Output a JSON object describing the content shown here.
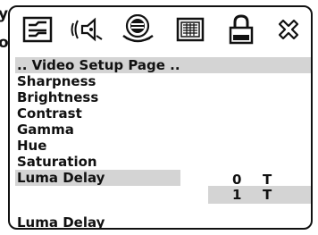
{
  "edge_labels": [
    "y",
    "o"
  ],
  "icons": [
    {
      "name": "general-setup-icon",
      "label": ""
    },
    {
      "name": "audio-setup-icon",
      "label": ""
    },
    {
      "name": "dolby-disc-icon",
      "label": ""
    },
    {
      "name": "video-setup-icon",
      "label": ""
    },
    {
      "name": "lock-icon",
      "label": ""
    },
    {
      "name": "exit-icon",
      "label": ""
    }
  ],
  "page_title": ".. Video Setup Page ..",
  "menu_items": [
    {
      "label": "Sharpness"
    },
    {
      "label": "Brightness"
    },
    {
      "label": "Contrast"
    },
    {
      "label": "Gamma"
    },
    {
      "label": "Hue"
    },
    {
      "label": "Saturation"
    },
    {
      "label": "Luma Delay"
    }
  ],
  "options": [
    {
      "value": "0",
      "unit": "T"
    },
    {
      "value": "1",
      "unit": "T"
    }
  ],
  "footer_text": "Luma Delay",
  "colors": {
    "highlight": "#d4d4d4",
    "border": "#111111",
    "background": "#ffffff"
  }
}
